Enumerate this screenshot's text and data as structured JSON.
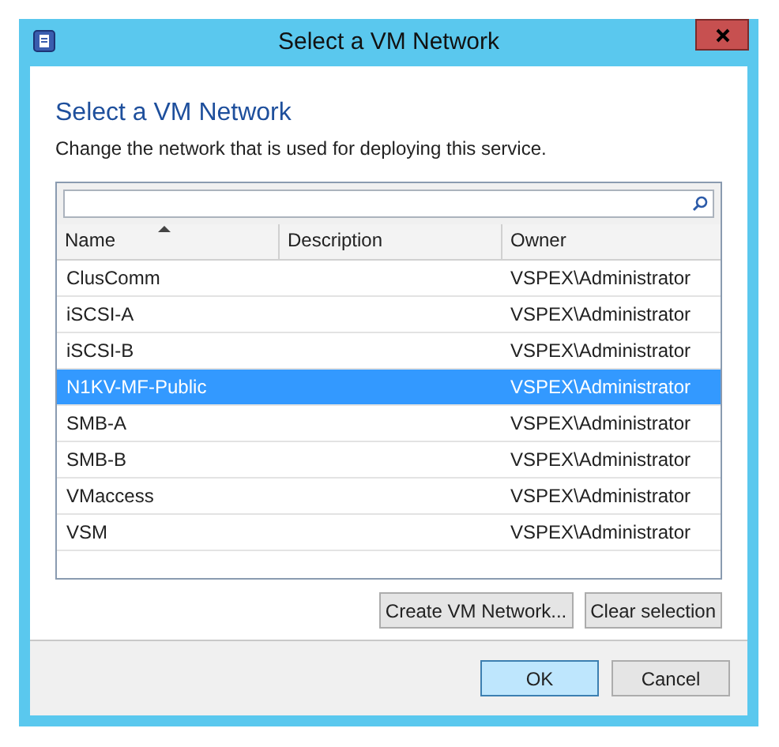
{
  "window": {
    "title": "Select a VM Network"
  },
  "heading": "Select a VM Network",
  "subtitle": "Change the network that is used for deploying this service.",
  "table": {
    "columns": [
      {
        "label": "Name",
        "sorted": true
      },
      {
        "label": "Description",
        "sorted": false
      },
      {
        "label": "Owner",
        "sorted": false
      }
    ],
    "rows": [
      {
        "name": "ClusComm",
        "owner": "VSPEX\\Administrator",
        "selected": false
      },
      {
        "name": "iSCSI-A",
        "owner": "VSPEX\\Administrator",
        "selected": false
      },
      {
        "name": "iSCSI-B",
        "owner": "VSPEX\\Administrator",
        "selected": false
      },
      {
        "name": "N1KV-MF-Public",
        "owner": "VSPEX\\Administrator",
        "selected": true
      },
      {
        "name": "SMB-A",
        "owner": "VSPEX\\Administrator",
        "selected": false
      },
      {
        "name": "SMB-B",
        "owner": "VSPEX\\Administrator",
        "selected": false
      },
      {
        "name": "VMaccess",
        "owner": "VSPEX\\Administrator",
        "selected": false
      },
      {
        "name": "VSM",
        "owner": "VSPEX\\Administrator",
        "selected": false
      }
    ]
  },
  "list_buttons": [
    "Create VM Network...",
    "Clear selection"
  ],
  "footer_buttons": [
    {
      "label": "OK",
      "default": true
    },
    {
      "label": "Cancel",
      "default": false
    }
  ]
}
